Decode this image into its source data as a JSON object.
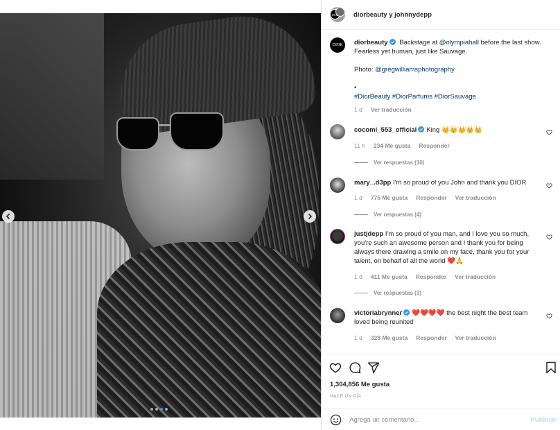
{
  "media": {
    "dots_total": 4,
    "dots_active_index": 2
  },
  "header": {
    "avatar_text": "DIOR",
    "title": "diorbeauty y johnnydepp"
  },
  "caption": {
    "avatar_text": "DIOR",
    "username": "diorbeauty",
    "line1_pre": "Backstage at ",
    "line1_mention": "@olympiahall",
    "line1_post": " before the last show.",
    "line2": "Fearless yet human, just like Sauvage.",
    "photo_label": "Photo: ",
    "photo_mention": "@gregwilliamsphotography",
    "bullet": "•",
    "hashtags": "#DiorBeauty #DiorParfums #DiorSauvage",
    "time": "1 d",
    "translate": "Ver traducción"
  },
  "comments": [
    {
      "username": "cocomi_553_official",
      "text": "King 👑👑👑👑👑",
      "time": "11 h",
      "likes": "234 Me gusta",
      "reply": "Responder",
      "translate": "",
      "replies": "Ver respuestas (10)"
    },
    {
      "username": "mary_.d3pp",
      "text": "I'm so proud of you John and thank you DIOR",
      "time": "1 d",
      "likes": "775 Me gusta",
      "reply": "Responder",
      "translate": "Ver traducción",
      "replies": "Ver respuestas (4)"
    },
    {
      "username": "justjdepp",
      "text": "I'm so proud of you man, and I love you so much, you're such an awesome person and I thank you for being always there drawing a smile on my face, thank you for your talent, on behalf of all the world ❤️🙏",
      "time": "1 d",
      "likes": "411 Me gusta",
      "reply": "Responder",
      "translate": "Ver traducción",
      "replies": "Ver respuestas (3)"
    },
    {
      "username": "victoriabrynner",
      "text": "❤️❤️❤️❤️ the best night the best team loved being reunited",
      "time": "1 d",
      "likes": "328 Me gusta",
      "reply": "Responder",
      "translate": "Ver traducción",
      "replies": ""
    }
  ],
  "footer": {
    "likes": "1,304,856 Me gusta",
    "ago": "HACE UN DÍA",
    "comment_placeholder": "Agrega un comentario...",
    "publish": "Publicar"
  },
  "colors": {
    "link": "#00376b",
    "verified": "#3897f0",
    "muted": "#8e8e8e",
    "publish_disabled": "#b2dffc"
  },
  "icons": [
    "chevron-left-icon",
    "chevron-right-icon",
    "verified-badge-icon",
    "heart-icon",
    "comment-icon",
    "share-icon",
    "bookmark-icon",
    "emoji-icon"
  ]
}
